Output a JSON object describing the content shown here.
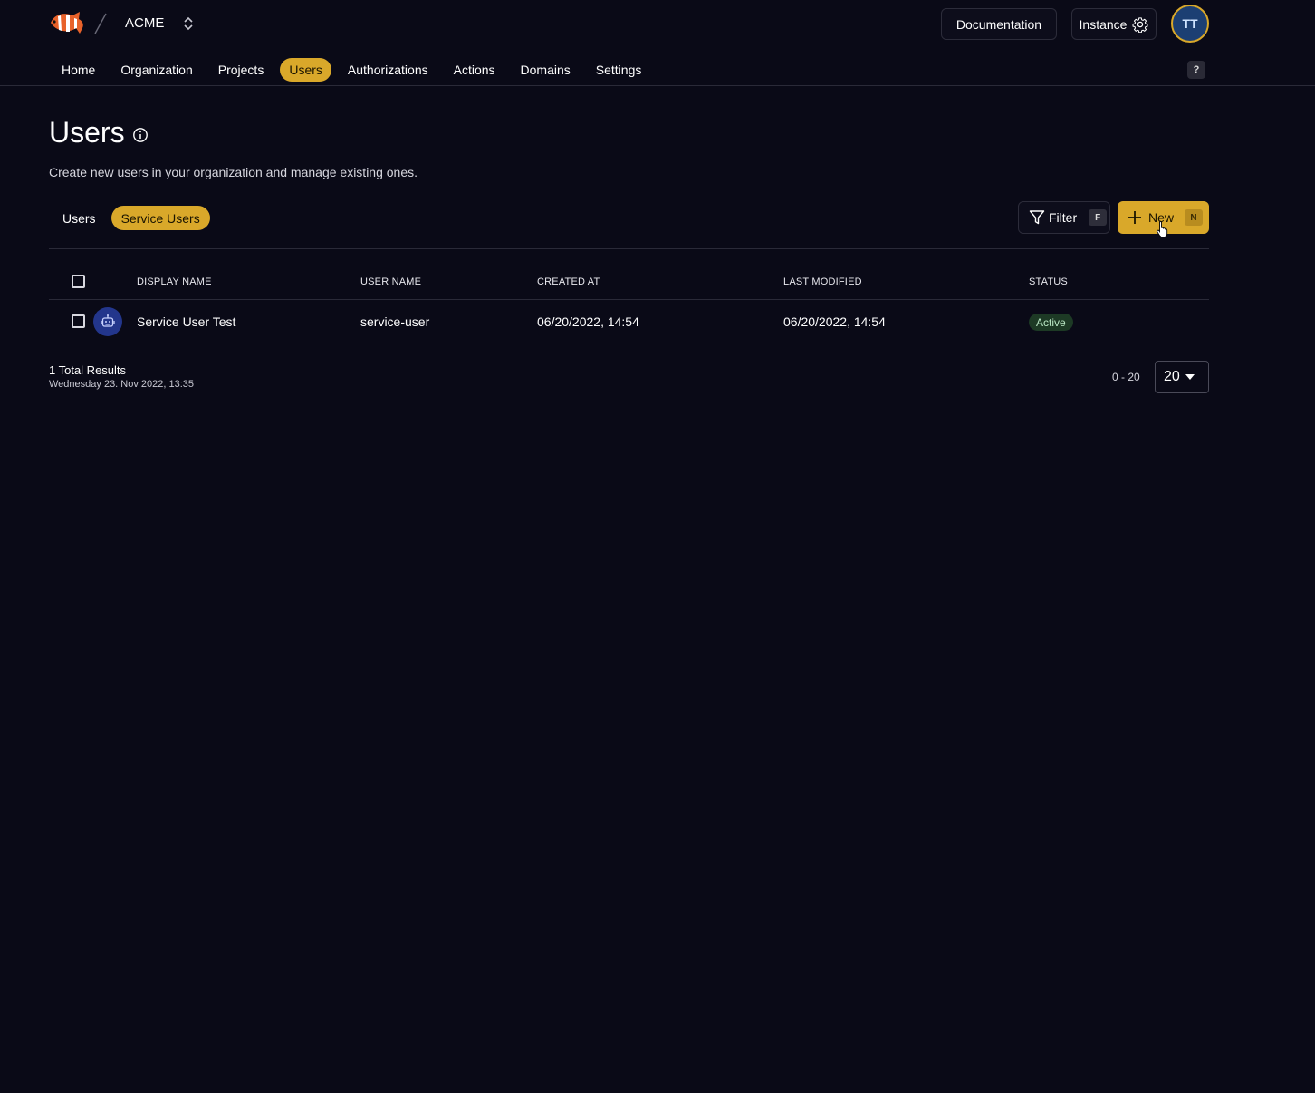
{
  "header": {
    "org_name": "ACME",
    "docs_label": "Documentation",
    "instance_label": "Instance",
    "avatar_initials": "TT"
  },
  "nav": {
    "items": [
      {
        "label": "Home",
        "active": false
      },
      {
        "label": "Organization",
        "active": false
      },
      {
        "label": "Projects",
        "active": false
      },
      {
        "label": "Users",
        "active": true
      },
      {
        "label": "Authorizations",
        "active": false
      },
      {
        "label": "Actions",
        "active": false
      },
      {
        "label": "Domains",
        "active": false
      },
      {
        "label": "Settings",
        "active": false
      }
    ],
    "help_label": "?"
  },
  "page": {
    "title": "Users",
    "description": "Create new users in your organization and manage existing ones."
  },
  "subtabs": {
    "items": [
      {
        "label": "Users",
        "active": false
      },
      {
        "label": "Service Users",
        "active": true
      }
    ]
  },
  "toolbar": {
    "filter_label": "Filter",
    "filter_shortcut": "F",
    "new_label": "New",
    "new_shortcut": "N"
  },
  "table": {
    "columns": [
      "DISPLAY NAME",
      "USER NAME",
      "CREATED AT",
      "LAST MODIFIED",
      "STATUS"
    ],
    "rows": [
      {
        "display_name": "Service User Test",
        "user_name": "service-user",
        "created_at": "06/20/2022, 14:54",
        "last_modified": "06/20/2022, 14:54",
        "status": "Active"
      }
    ]
  },
  "footer": {
    "total": "1 Total Results",
    "timestamp": "Wednesday 23. Nov 2022, 13:35",
    "range": "0 - 20",
    "page_size": "20"
  },
  "colors": {
    "background": "#0a0a17",
    "accent": "#d9a82a",
    "active_badge_bg": "#1d3a25",
    "avatar_bg": "#23368c"
  },
  "icons": {
    "logo": "clownfish-logo-icon",
    "org_switch": "chevron-up-down-icon",
    "instance": "gear-icon",
    "info": "info-circle-icon",
    "filter": "filter-funnel-icon",
    "new": "plus-icon",
    "row_avatar": "robot-icon",
    "page_size": "caret-down-icon"
  }
}
